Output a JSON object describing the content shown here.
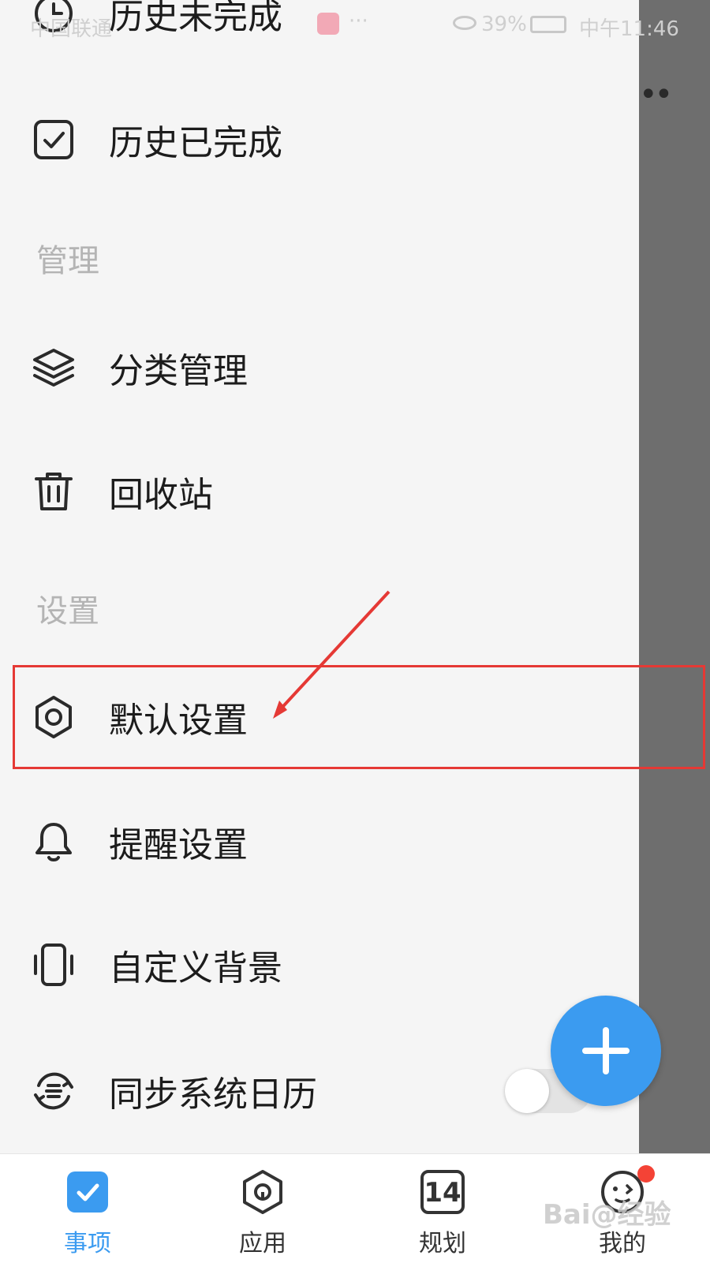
{
  "status_bar": {
    "carrier": "中国联通",
    "dots": "···",
    "battery": "39%",
    "time": "中午11:46"
  },
  "drawer": {
    "items_top": [
      {
        "label": "历史未完成",
        "icon": "clock-icon"
      },
      {
        "label": "历史已完成",
        "icon": "checkbox-icon"
      }
    ],
    "section_manage": "管理",
    "items_manage": [
      {
        "label": "分类管理",
        "icon": "layers-icon"
      },
      {
        "label": "回收站",
        "icon": "trash-icon"
      }
    ],
    "section_settings": "设置",
    "items_settings": [
      {
        "label": "默认设置",
        "icon": "gear-icon"
      },
      {
        "label": "提醒设置",
        "icon": "bell-icon"
      },
      {
        "label": "自定义背景",
        "icon": "phone-vibrate-icon"
      },
      {
        "label": "同步系统日历",
        "icon": "sync-calendar-icon",
        "toggle": false
      }
    ]
  },
  "fab": {
    "icon": "plus-icon"
  },
  "bottom_nav": [
    {
      "label": "事项",
      "icon": "check-square-icon",
      "active": true
    },
    {
      "label": "应用",
      "icon": "app-hexagon-icon",
      "active": false
    },
    {
      "label": "规划",
      "icon": "calendar-14-icon",
      "calendar_number": "14",
      "active": false
    },
    {
      "label": "我的",
      "icon": "smiley-icon",
      "active": false,
      "notification_dot": true
    }
  ],
  "watermark": "Bai@经验",
  "colors": {
    "accent": "#3b9bf0",
    "highlight": "#e53935",
    "notification": "#f44336"
  }
}
